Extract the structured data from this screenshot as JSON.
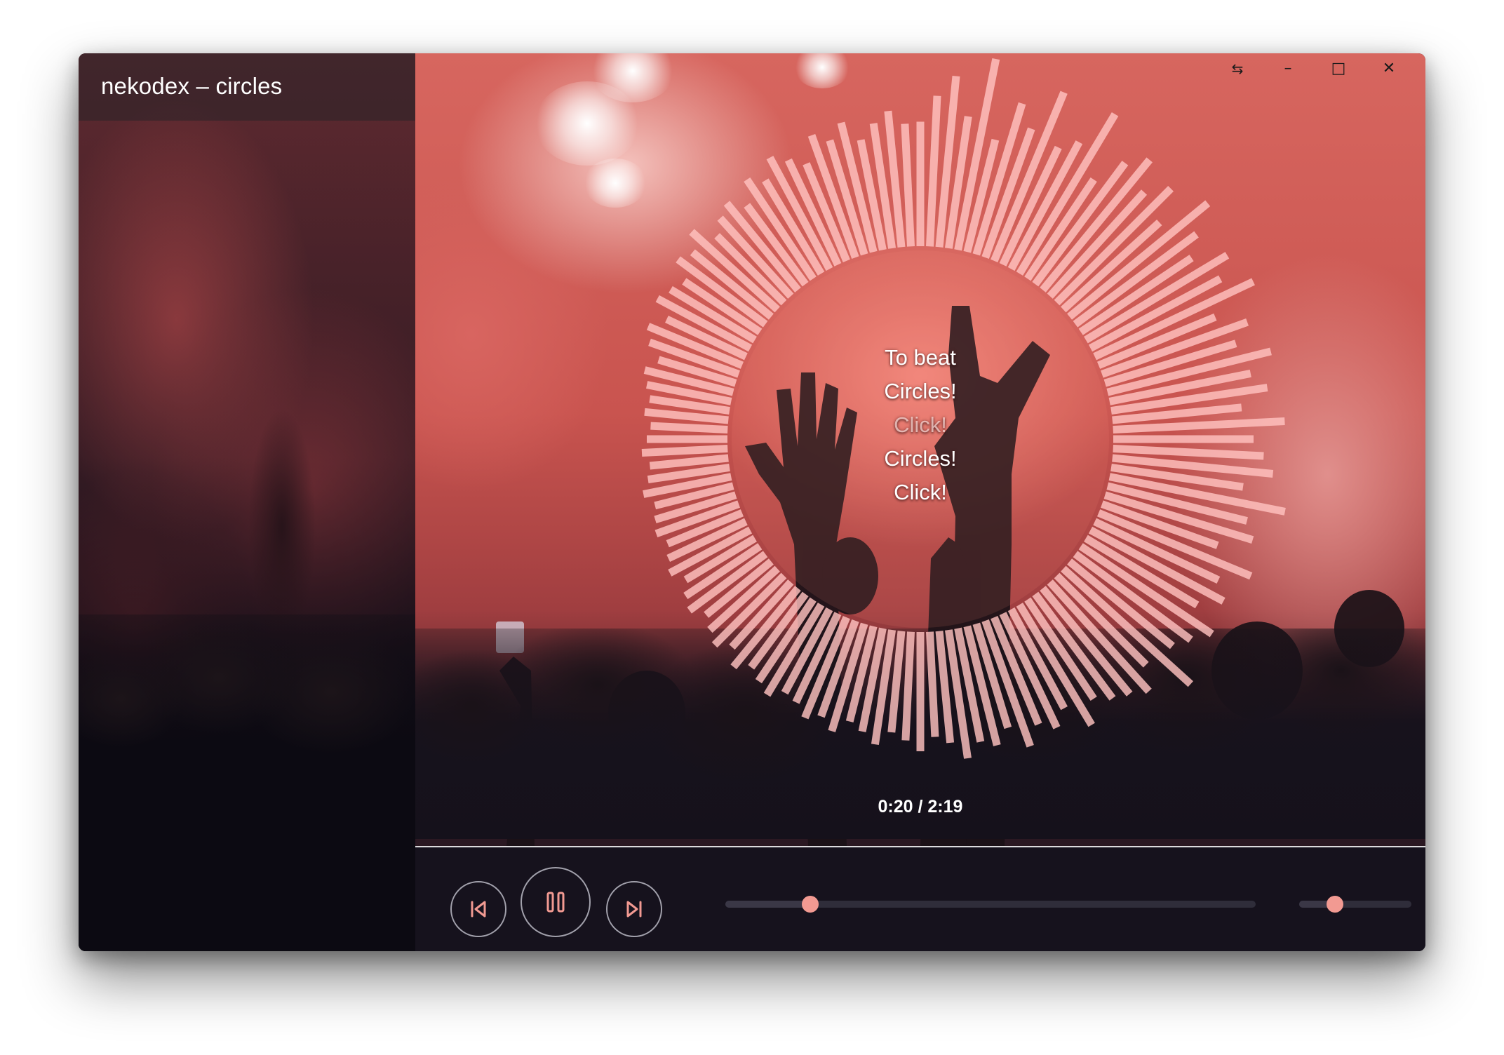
{
  "window": {
    "title": "nekodex – circles"
  },
  "window_controls": {
    "swap_icon": "⇆",
    "minimize_icon": "–",
    "maximize_icon": "□",
    "close_icon": "✕"
  },
  "lyrics": [
    "To beat",
    "Circles!",
    "Click!",
    "Circles!",
    "Click!"
  ],
  "playback": {
    "time_readout": "0:20 / 2:19",
    "progress_fraction": 0.16,
    "volume_fraction": 0.32
  },
  "controls": {
    "previous_icon": "skip-previous",
    "pause_icon": "pause",
    "next_icon": "skip-next"
  },
  "colors": {
    "accent": "#f29a92",
    "visualizer_bar": "#ffc2c0",
    "control_bar_bg": "#16121d"
  },
  "visualizer": {
    "bar_levels": [
      0.55,
      0.7,
      0.82,
      0.6,
      0.95,
      0.5,
      0.74,
      0.62,
      0.88,
      0.58,
      0.66,
      0.9,
      0.52,
      0.7,
      0.8,
      0.64,
      0.76,
      0.58,
      0.86,
      0.7,
      0.6,
      0.78,
      0.68,
      0.84,
      0.56,
      0.72,
      0.62,
      0.8,
      0.66,
      0.74,
      0.58,
      0.82,
      0.64,
      0.7,
      0.76,
      0.6,
      0.86,
      0.66,
      0.72,
      0.54,
      0.78,
      0.62,
      0.7,
      0.58,
      0.74,
      0.66,
      0.6,
      0.82,
      0.56,
      0.68,
      0.62,
      0.58,
      0.52,
      0.64,
      0.48,
      0.56,
      0.5,
      0.6,
      0.46,
      0.54,
      0.5,
      0.58,
      0.48,
      0.44,
      0.52,
      0.46,
      0.42,
      0.5,
      0.44,
      0.4,
      0.48,
      0.42,
      0.46,
      0.4,
      0.38,
      0.44,
      0.4,
      0.36,
      0.42,
      0.34,
      0.4,
      0.36,
      0.32,
      0.38,
      0.35,
      0.3,
      0.36,
      0.33,
      0.3,
      0.34,
      0.32,
      0.3,
      0.35,
      0.31,
      0.29,
      0.33,
      0.3,
      0.28,
      0.32,
      0.3,
      0.33,
      0.36,
      0.3,
      0.38,
      0.42,
      0.34,
      0.44,
      0.4,
      0.36,
      0.46,
      0.42,
      0.5,
      0.38,
      0.44,
      0.48,
      0.4,
      0.52,
      0.46,
      0.56,
      0.5,
      0.44,
      0.58,
      0.52,
      0.6,
      0.48,
      0.56,
      0.62,
      0.54
    ]
  }
}
